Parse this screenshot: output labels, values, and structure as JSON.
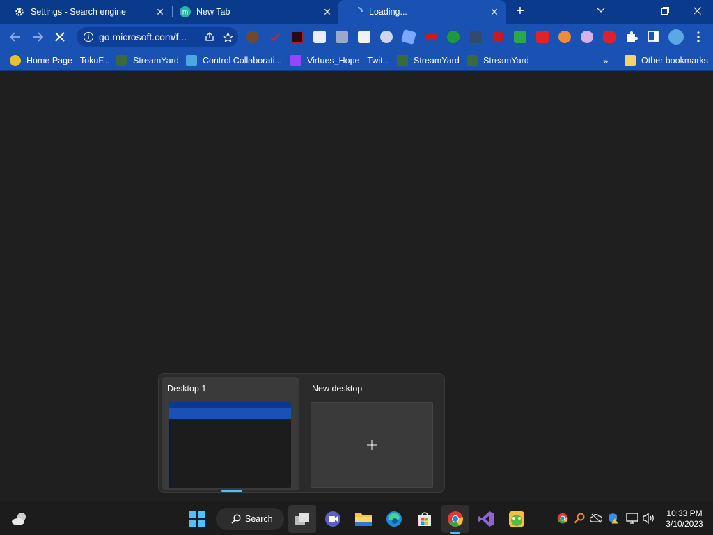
{
  "browser": {
    "tabs": [
      {
        "title": "Settings - Search engine",
        "icon": "gear-icon"
      },
      {
        "title": "New Tab",
        "icon": "m-logo-icon"
      },
      {
        "title": "Loading...",
        "icon": "spinner-icon"
      }
    ],
    "url": "go.microsoft.com/f...",
    "bookmarks": [
      {
        "label": "Home Page - TokuF...",
        "icon": "tokufan-icon"
      },
      {
        "label": "StreamYard",
        "icon": "streamyard-icon"
      },
      {
        "label": "Control Collaborati...",
        "icon": "monitor-icon"
      },
      {
        "label": "Virtues_Hope - Twit...",
        "icon": "twitch-icon"
      },
      {
        "label": "StreamYard",
        "icon": "streamyard-icon"
      },
      {
        "label": "StreamYard",
        "icon": "streamyard-icon"
      }
    ],
    "other_bookmarks": "Other bookmarks",
    "colors": {
      "frame": "#0a3a8c",
      "toolbar": "#1a52b3",
      "omnibox": "#0e3f99"
    }
  },
  "taskview": {
    "desktops": [
      {
        "label": "Desktop 1"
      },
      {
        "label": "New desktop"
      }
    ]
  },
  "taskbar": {
    "search_label": "Search",
    "time": "10:33 PM",
    "date": "3/10/2023",
    "accent": "#4cc2ff"
  }
}
